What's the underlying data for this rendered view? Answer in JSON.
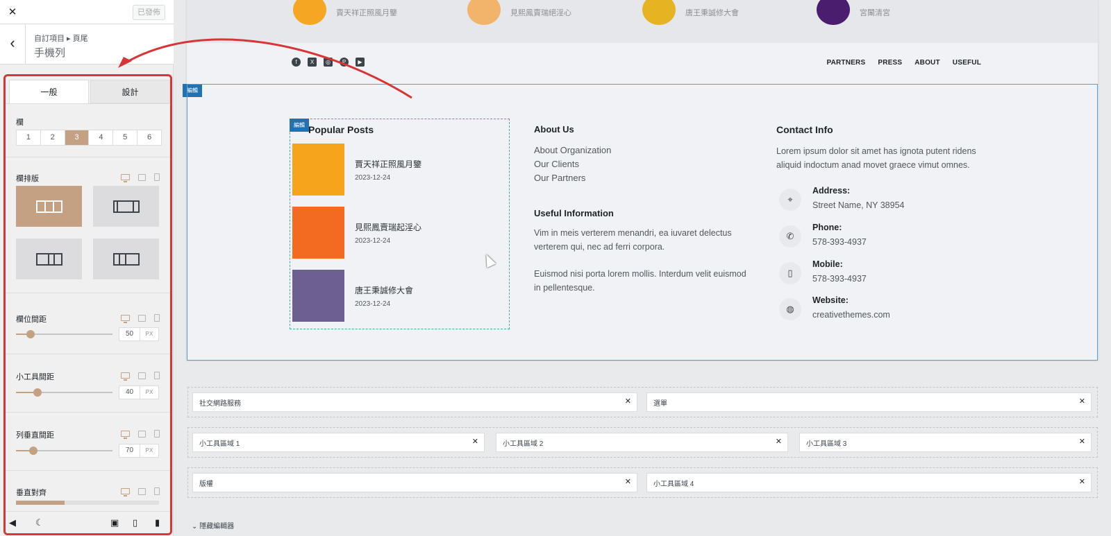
{
  "sidebar": {
    "close_icon": "close-icon",
    "publish_label": "已發佈",
    "breadcrumb": "自訂項目 ▸ 頁尾",
    "title": "手機列",
    "tabs": [
      "一般",
      "設計"
    ],
    "columns_label": "欄",
    "column_options": [
      "1",
      "2",
      "3",
      "4",
      "5",
      "6"
    ],
    "column_selected": "3",
    "layout_label": "欄排版",
    "column_gap": {
      "label": "欄位間距",
      "value": "50",
      "unit": "PX",
      "level": 0.15
    },
    "widget_gap": {
      "label": "小工具間距",
      "value": "40",
      "unit": "PX",
      "level": 0.22
    },
    "row_vgap": {
      "label": "列垂直間距",
      "value": "70",
      "unit": "PX",
      "level": 0.18
    },
    "vertical_align_label": "垂直對齊"
  },
  "preview": {
    "thumb_texts": [
      "賣天祥正照風月鑒",
      "見熙鳳賣瑞絕淫心",
      "唐王秉誠修大會",
      "宮闈清宮"
    ],
    "nav": [
      "PARTNERS",
      "PRESS",
      "ABOUT",
      "USEFUL"
    ],
    "edit_tag": "編輯",
    "popular_posts": {
      "title": "Popular Posts",
      "items": [
        {
          "title": "賈天祥正照風月鑒",
          "date": "2023-12-24"
        },
        {
          "title": "見熙鳳賣瑞起淫心",
          "date": "2023-12-24"
        },
        {
          "title": "唐王秉誠修大會",
          "date": "2023-12-24"
        }
      ]
    },
    "about": {
      "title": "About Us",
      "links": [
        "About Organization",
        "Our Clients",
        "Our Partners"
      ]
    },
    "useful": {
      "title": "Useful Information",
      "p1": "Vim in meis verterem menandri, ea iuvaret delectus verterem qui, nec ad ferri corpora.",
      "p2": "Euismod nisi porta lorem mollis. Interdum velit euismod in pellentesque."
    },
    "contact": {
      "title": "Contact Info",
      "text": "Lorem ipsum dolor sit amet has ignota putent ridens aliquid indoctum anad movet graece vimut omnes.",
      "items": [
        {
          "label": "Address:",
          "value": "Street Name, NY 38954"
        },
        {
          "label": "Phone:",
          "value": "578-393-4937"
        },
        {
          "label": "Mobile:",
          "value": "578-393-4937"
        },
        {
          "label": "Website:",
          "value": "creativethemes.com"
        }
      ]
    }
  },
  "builder": {
    "row1": [
      "社交網路服務",
      "選單"
    ],
    "row2": [
      "小工具區域 1",
      "小工具區域 2",
      "小工具區域 3"
    ],
    "row3": [
      "版權",
      "小工具區域 4"
    ],
    "hide_editor": "隱藏編輯器"
  },
  "colors": {
    "accent": "#c5a184",
    "highlight": "#d63638",
    "edit": "#2271b1"
  }
}
